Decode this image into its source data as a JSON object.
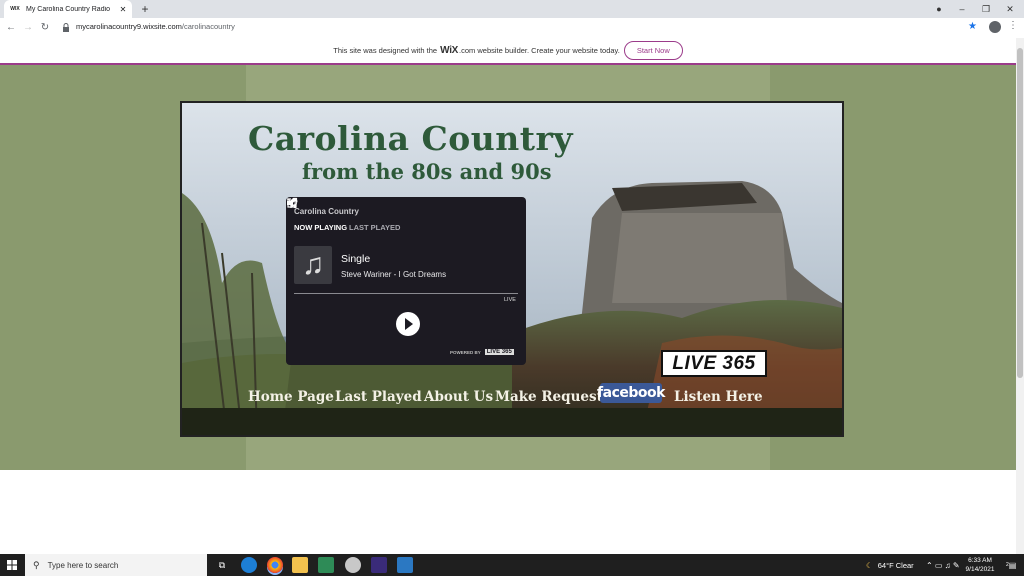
{
  "browser": {
    "tab_title": "My Carolina Country Radio",
    "tab_favicon_text": "WIX",
    "url_domain": "mycarolinacountry9.wixsite.com",
    "url_path": "/carolinacountry"
  },
  "wix_banner": {
    "text_before": "This site was designed with the",
    "brand": "WiX",
    "text_after": ".com website builder. Create your website today.",
    "button": "Start Now"
  },
  "site": {
    "title": "Carolina Country",
    "subtitle": "from the 80s and 90s",
    "nav": [
      "Home Page",
      "Last Played",
      "About Us",
      "Make Request",
      "Listen Here"
    ],
    "facebook": "facebook",
    "live365_logo": "LIVE 365"
  },
  "player": {
    "station": "Carolina Country",
    "tab_now": "NOW PLAYING",
    "tab_last": "LAST PLAYED",
    "track": "Single",
    "artist_song": "Steve Wariner - I Got Dreams",
    "live_label": "LIVE",
    "powered_by": "POWERED BY",
    "powered_logo": "LIVE 365"
  },
  "taskbar": {
    "search_placeholder": "Type here to search",
    "weather": "64°F  Clear",
    "time": "6:33 AM",
    "date": "9/14/2021",
    "notification_count": "2"
  },
  "colors": {
    "wix_accent": "#9b3b8a",
    "site_bg": "#8a9a6e",
    "title_green": "#2e5a3a",
    "player_bg": "#1c1a22",
    "facebook_blue": "#3b5998"
  }
}
